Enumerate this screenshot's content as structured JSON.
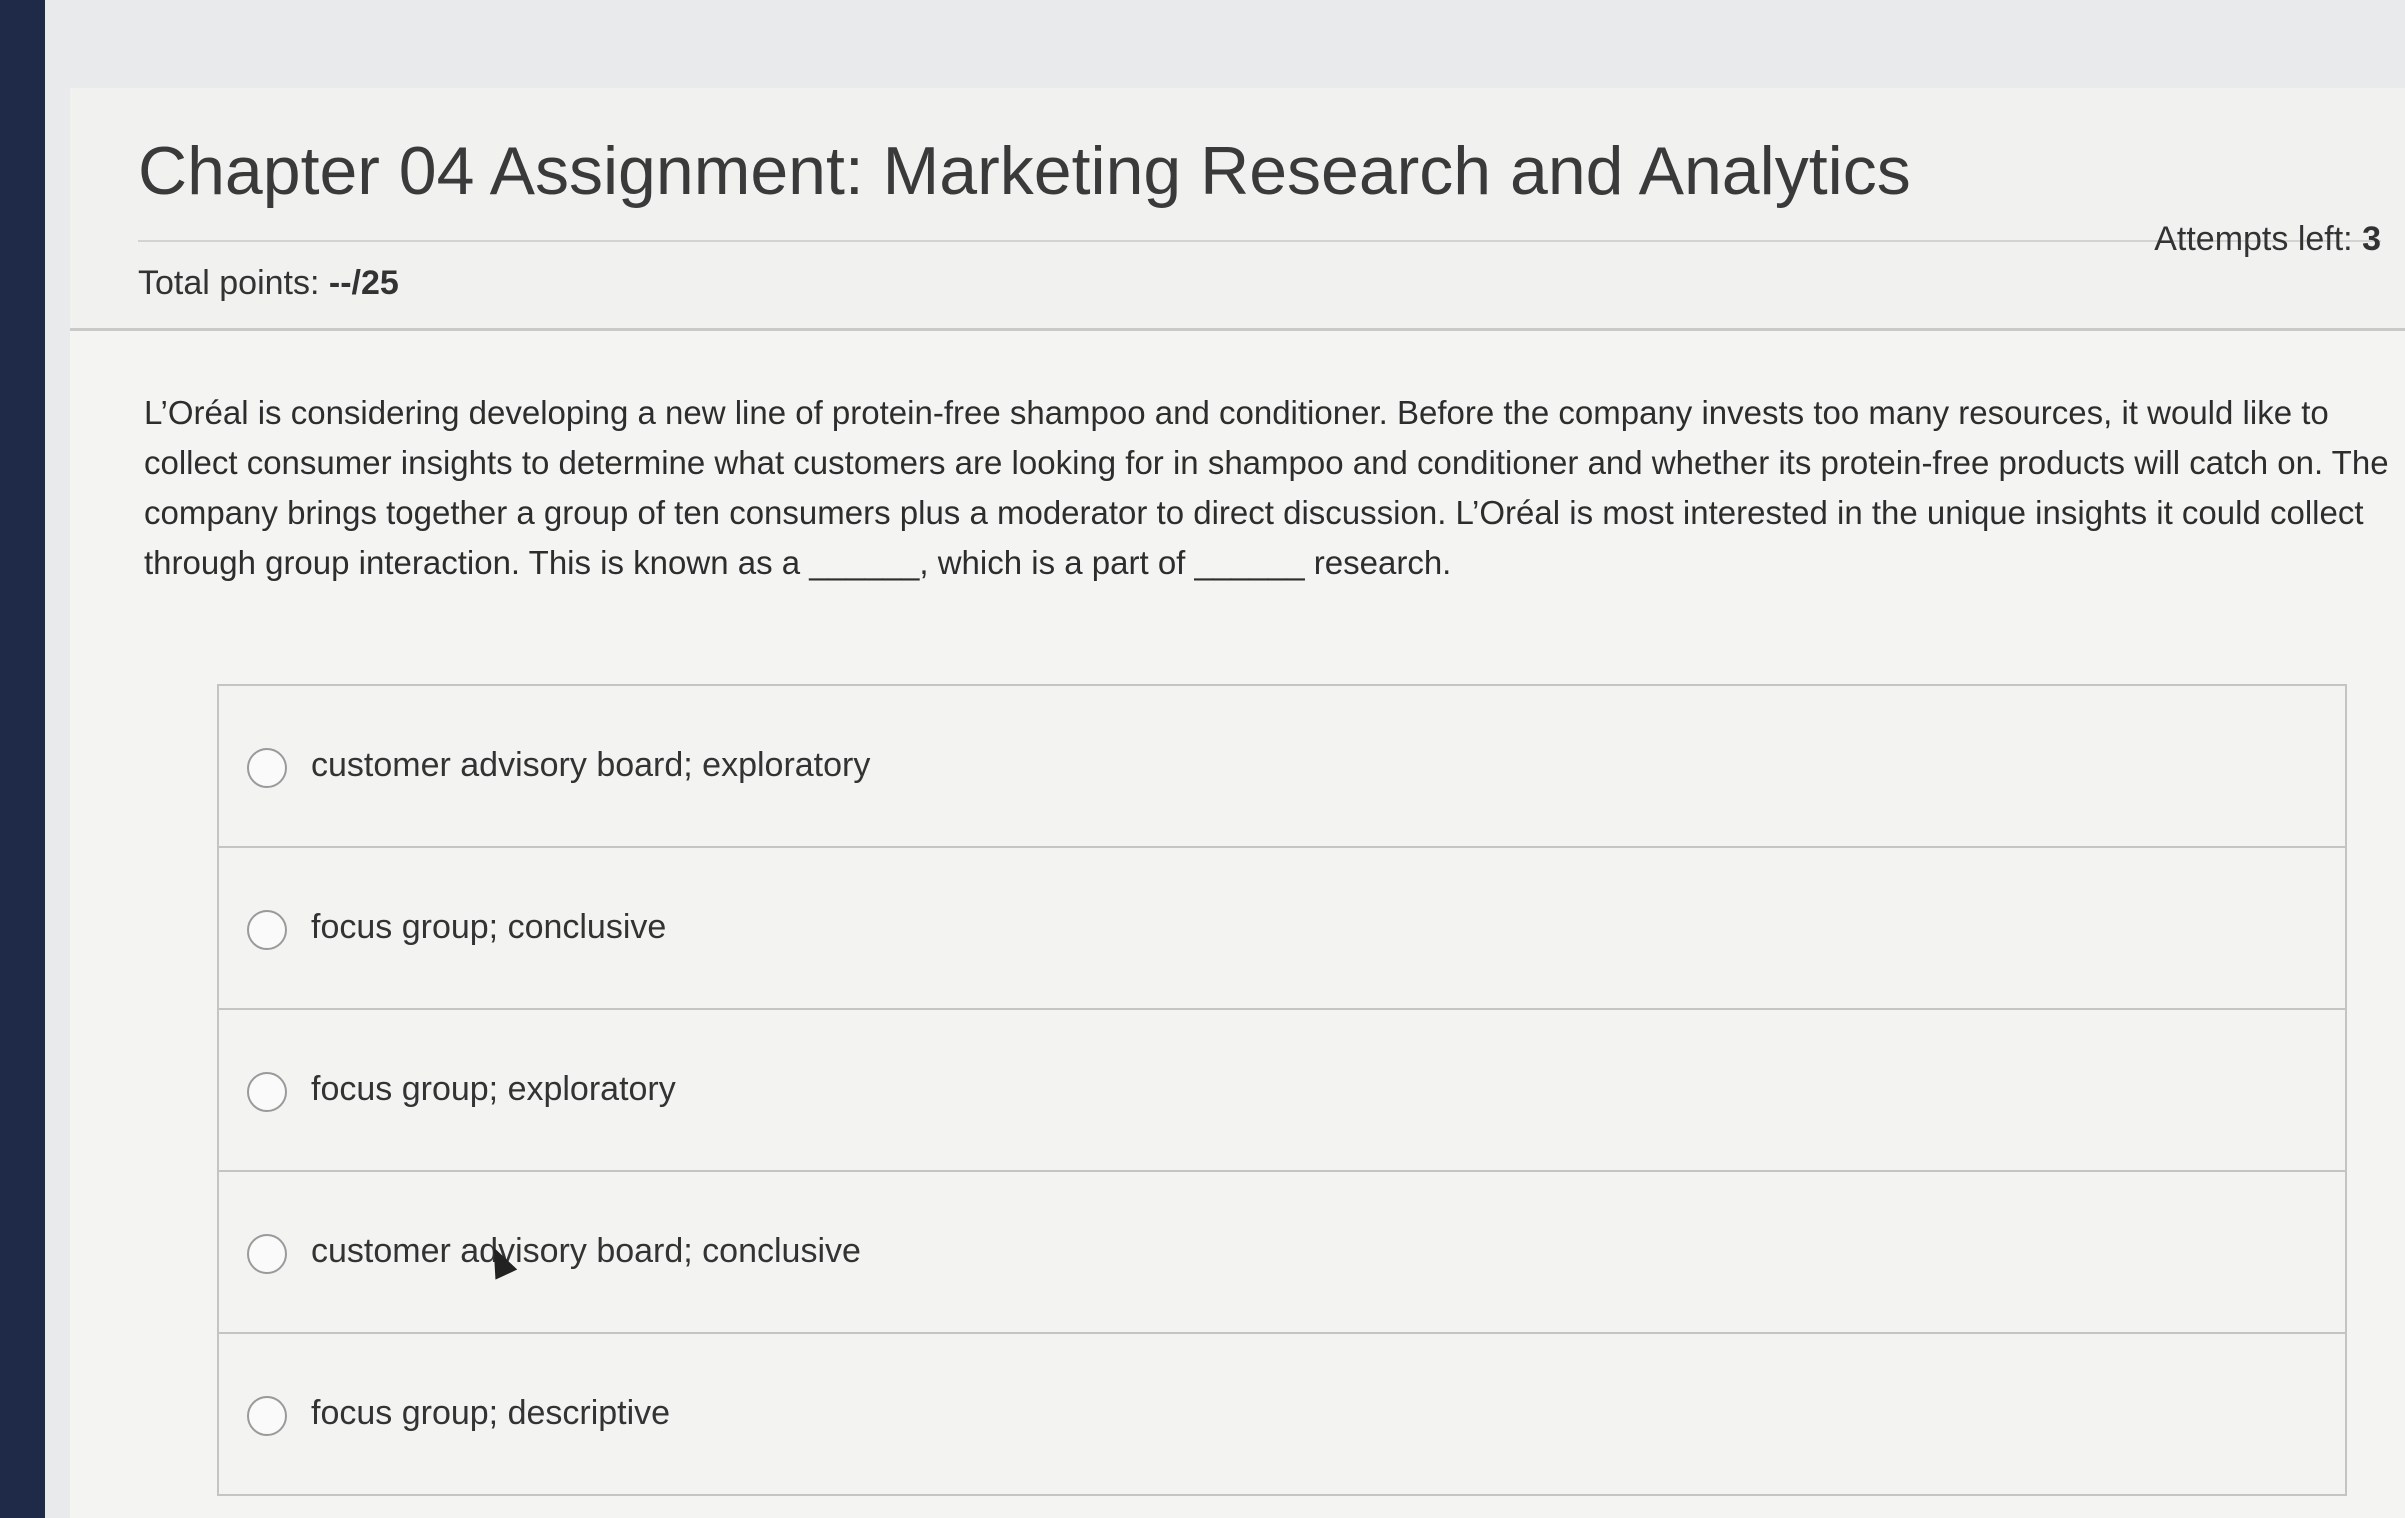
{
  "assignment": {
    "title": "Chapter 04 Assignment: Marketing Research and Analytics",
    "total_points_label": "Total points: ",
    "total_points_value": "--/25",
    "attempts_label": "Attempts left: ",
    "attempts_value": "3"
  },
  "question": {
    "text": "L’Oréal is considering developing a new line of protein-free shampoo and conditioner. Before the company invests too many resources, it would like to collect consumer insights to determine what customers are looking for in shampoo and conditioner and whether its protein-free products will catch on. The company brings together a group of ten consumers plus a moderator to direct discussion. L’Oréal is most interested in the unique insights it could collect through group interaction. This is known as a ______, which is a part of ______ research."
  },
  "options": [
    {
      "label": "customer advisory board; exploratory"
    },
    {
      "label": "focus group; conclusive"
    },
    {
      "label": "focus group; exploratory"
    },
    {
      "label": "customer advisory board; conclusive"
    },
    {
      "label": "focus group; descriptive"
    }
  ]
}
